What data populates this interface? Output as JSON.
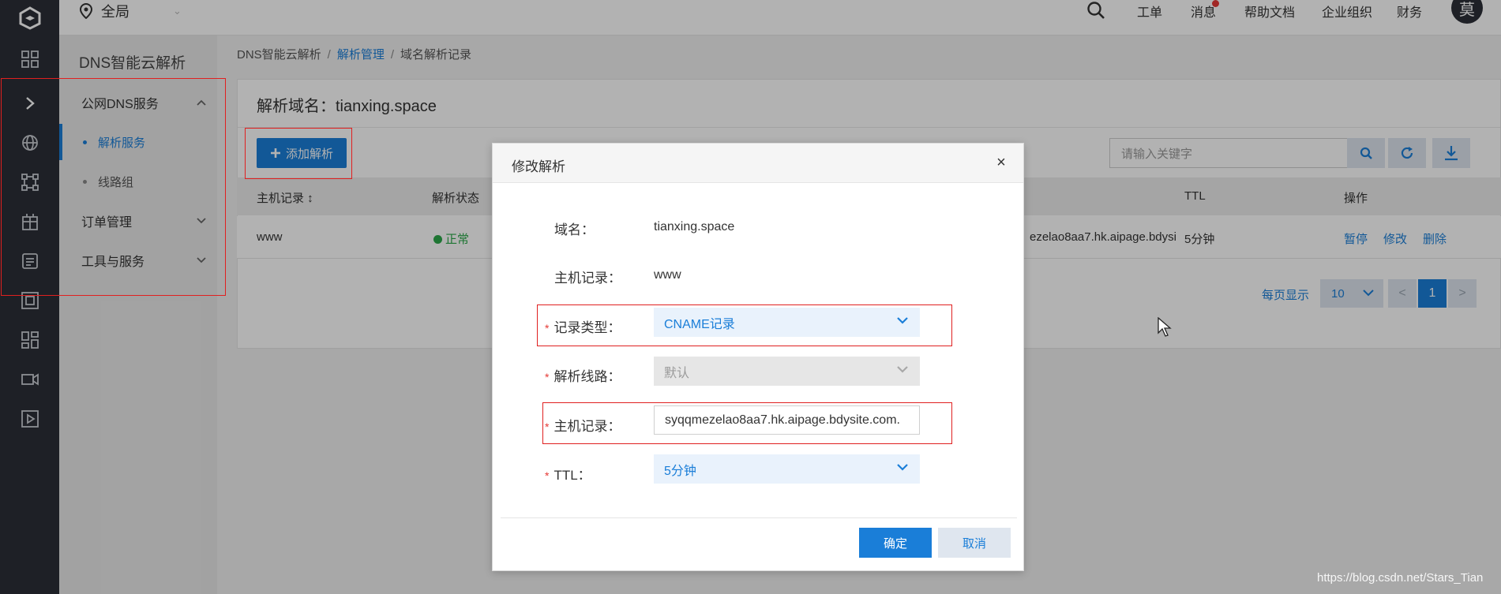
{
  "topbar": {
    "region": "全局",
    "nav": [
      "工单",
      "消息",
      "帮助文档",
      "企业组织",
      "财务"
    ],
    "avatar_initial": "莫"
  },
  "sidebar": {
    "title": "DNS智能云解析",
    "groups": [
      {
        "label": "公网DNS服务",
        "expanded": true
      },
      {
        "label": "订单管理",
        "expanded": false
      },
      {
        "label": "工具与服务",
        "expanded": false
      }
    ],
    "sub_items": [
      {
        "label": "解析服务",
        "active": true
      },
      {
        "label": "线路组",
        "active": false
      }
    ]
  },
  "breadcrumb": [
    "DNS智能云解析",
    "解析管理",
    "域名解析记录"
  ],
  "page": {
    "title": "解析域名：tianxing.space",
    "add_button": "添加解析",
    "search_placeholder": "请输入关键字"
  },
  "table": {
    "headers": {
      "host": "主机记录",
      "status": "解析状态",
      "ttl": "TTL",
      "ops": "操作"
    },
    "rows": [
      {
        "host": "www",
        "status": "正常",
        "value": "ezelao8aa7.hk.aipage.bdysi",
        "ttl": "5分钟",
        "ops": [
          "暂停",
          "修改",
          "删除"
        ]
      }
    ]
  },
  "pager": {
    "label": "每页显示",
    "page_size": "10",
    "prev": "<",
    "current": "1",
    "next": ">"
  },
  "modal": {
    "title": "修改解析",
    "close": "×",
    "domain_label": "域名：",
    "domain_value": "tianxing.space",
    "host_label": "主机记录：",
    "host_value": "www",
    "type_label": "记录类型：",
    "type_value": "CNAME记录",
    "line_label": "解析线路：",
    "line_value": "默认",
    "record_label": "主机记录：",
    "record_value": "syqqmezelao8aa7.hk.aipage.bdysite.com.",
    "ttl_label": "TTL：",
    "ttl_value": "5分钟",
    "required_mark": "*",
    "ok": "确定",
    "cancel": "取消"
  },
  "colors": {
    "primary": "#1a7ed8",
    "rail": "#2b2f37",
    "ok": "#2ca84a",
    "annotation": "#e02020"
  },
  "watermark": "https://blog.csdn.net/Stars_Tian"
}
